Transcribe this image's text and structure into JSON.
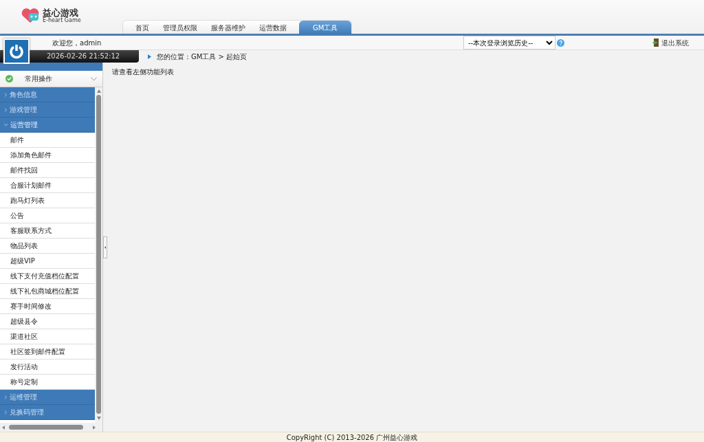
{
  "logo": {
    "title": "益心游戏",
    "subtitle": "E-heart Game"
  },
  "tabs": [
    {
      "label": "首页",
      "selected": false
    },
    {
      "label": "管理员权限",
      "selected": false
    },
    {
      "label": "服务器维护",
      "selected": false
    },
    {
      "label": "运营数据",
      "selected": false
    },
    {
      "label": "GM工具",
      "selected": true
    }
  ],
  "welcome": "欢迎您，admin",
  "history_select": {
    "value": "--本次登录浏览历史--"
  },
  "logout": "退出系统",
  "datetime": "2026-02-26 21:52:12",
  "breadcrumb": "您的位置：GM工具 > 起始页",
  "sidebar": {
    "title": "常用操作",
    "groups": [
      {
        "label": "角色信息",
        "expanded": false
      },
      {
        "label": "游戏管理",
        "expanded": false
      },
      {
        "label": "运营管理",
        "expanded": true,
        "children": [
          {
            "label": "邮件"
          },
          {
            "label": "添加角色邮件"
          },
          {
            "label": "邮件找回"
          },
          {
            "label": "合服计划邮件"
          },
          {
            "label": "跑马灯列表"
          },
          {
            "label": "公告"
          },
          {
            "label": "客服联系方式"
          },
          {
            "label": "物品列表"
          },
          {
            "label": "超级VIP"
          },
          {
            "label": "线下支付充值档位配置"
          },
          {
            "label": "线下礼包商城档位配置"
          },
          {
            "label": "赛手时间修改"
          },
          {
            "label": "超级县令"
          },
          {
            "label": "渠道社区"
          },
          {
            "label": "社区签到邮件配置"
          },
          {
            "label": "发行活动"
          },
          {
            "label": "称号定制"
          }
        ]
      },
      {
        "label": "运维管理",
        "expanded": false
      },
      {
        "label": "兑换码管理",
        "expanded": false
      }
    ]
  },
  "content": "请查看左侧功能列表",
  "footer": "CopyRight (C) 2013-2026 广州益心游戏"
}
